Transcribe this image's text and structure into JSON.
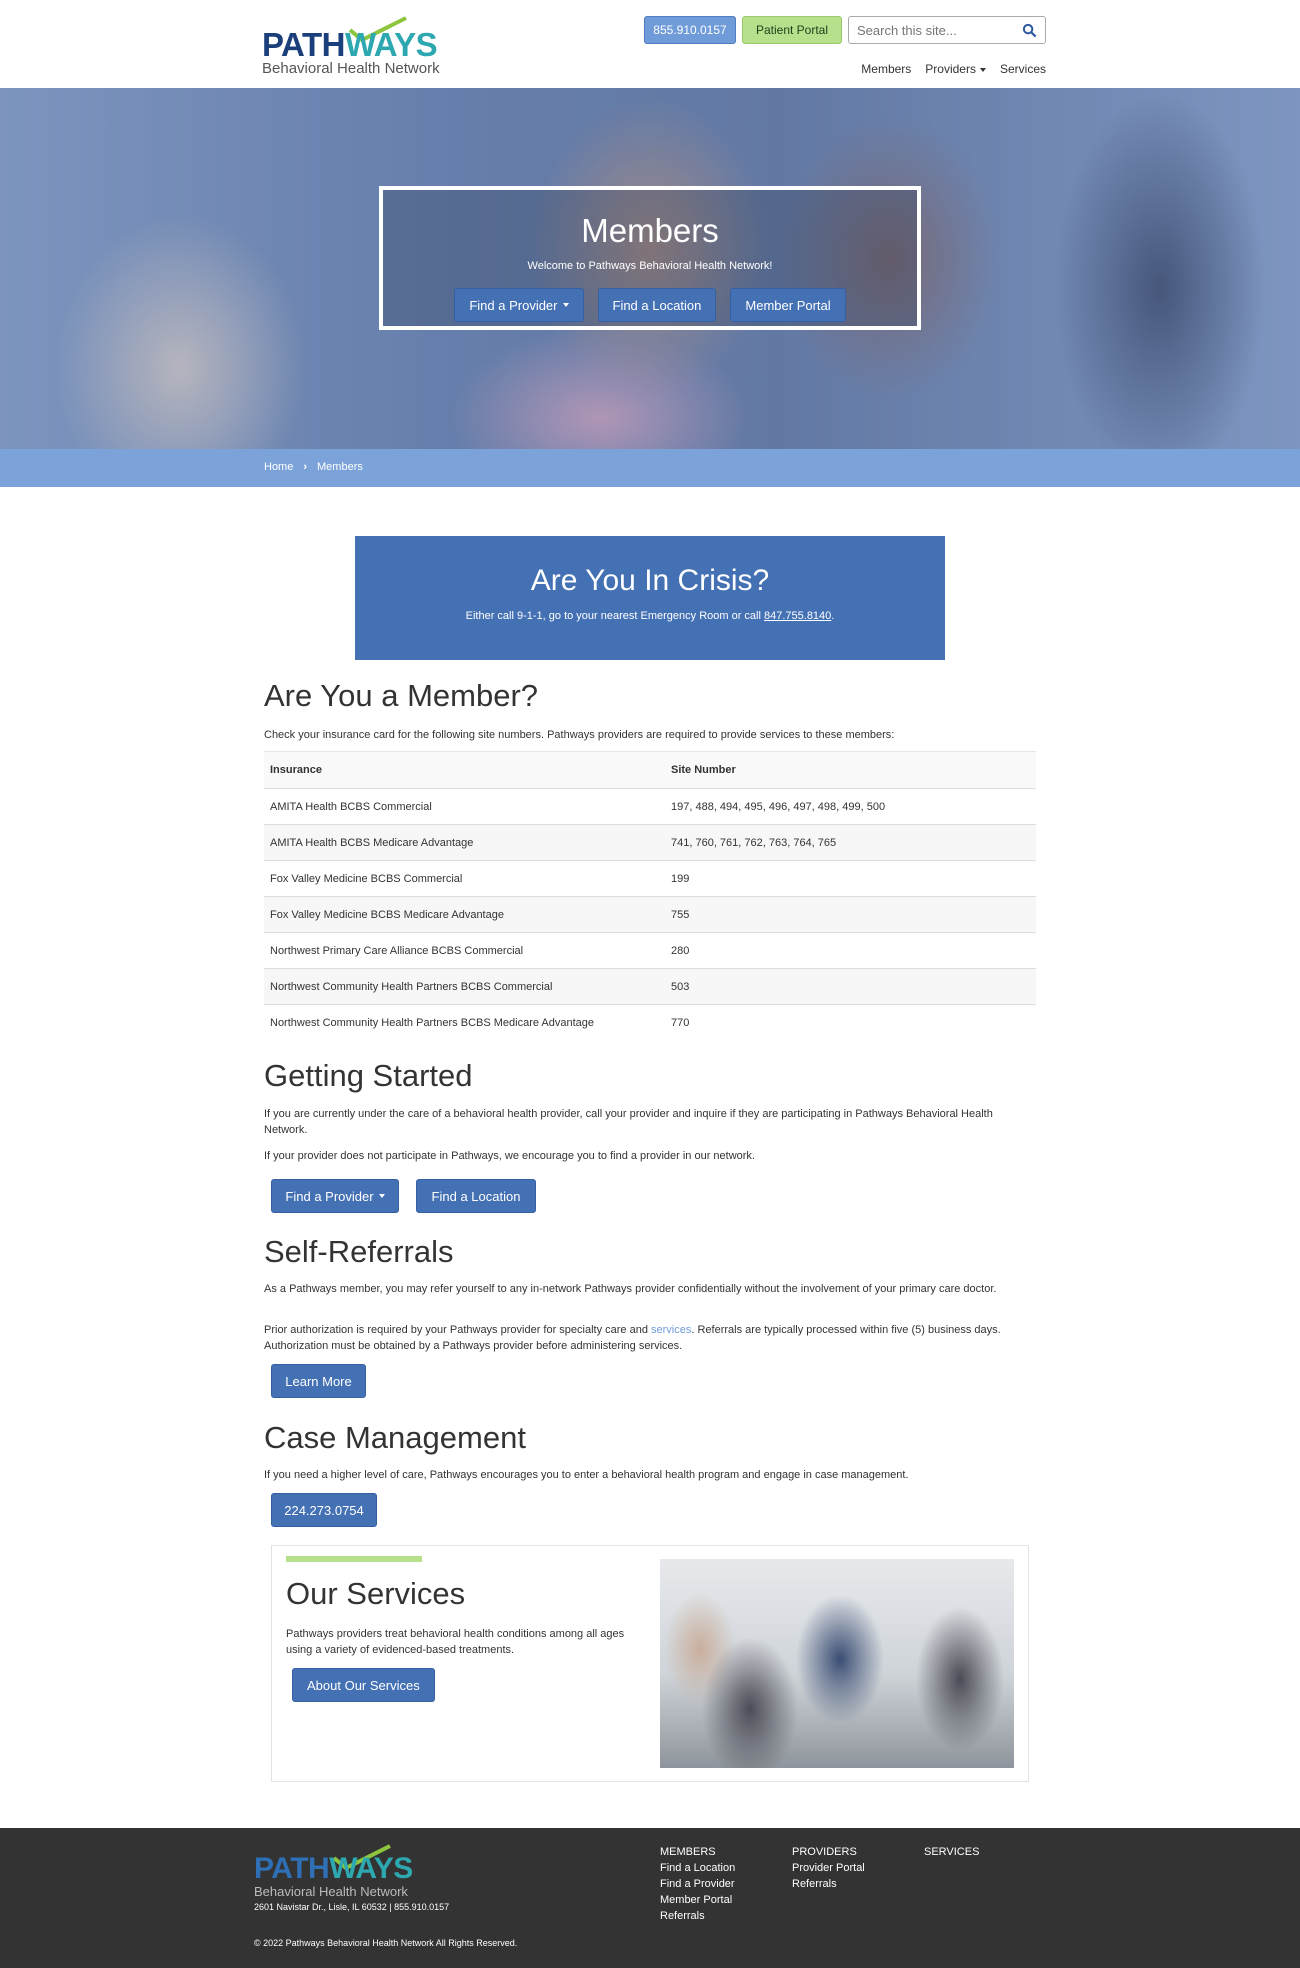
{
  "header": {
    "logo_word_dark": "PATH",
    "logo_word_teal": "WAYS",
    "logo_tagline": "Behavioral Health Network",
    "phone_button": "855.910.0157",
    "portal_button": "Patient Portal",
    "search_placeholder": "Search this site...",
    "nav": [
      "Members",
      "Providers",
      "Services"
    ]
  },
  "hero": {
    "title": "Members",
    "subtitle": "Welcome to Pathways Behavioral Health Network!",
    "buttons": [
      "Find a Provider",
      "Find a Location",
      "Member Portal"
    ]
  },
  "breadcrumb": [
    "Home",
    "Members"
  ],
  "crisis": {
    "title": "Are You In Crisis?",
    "text_before": "Either call 9-1-1, go to your nearest Emergency Room or call ",
    "phone": "847.755.8140",
    "text_after": "."
  },
  "member": {
    "title": "Are You a Member?",
    "intro": "Check your insurance card for the following site numbers. Pathways providers are required to provide services to these members:",
    "headers": [
      "Insurance",
      "Site Number"
    ],
    "rows": [
      [
        "AMITA Health BCBS Commercial",
        "197, 488, 494, 495, 496, 497, 498, 499, 500"
      ],
      [
        "AMITA Health BCBS Medicare Advantage",
        "741, 760, 761, 762, 763, 764, 765"
      ],
      [
        "Fox Valley Medicine BCBS Commercial",
        "199"
      ],
      [
        "Fox Valley Medicine BCBS Medicare Advantage",
        "755"
      ],
      [
        "Northwest Primary Care Alliance BCBS Commercial",
        "280"
      ],
      [
        "Northwest Community Health Partners BCBS Commercial",
        "503"
      ],
      [
        "Northwest Community Health Partners BCBS Medicare Advantage",
        "770"
      ]
    ]
  },
  "getting_started": {
    "title": "Getting Started",
    "p1": "If you are currently under the care of a behavioral health provider, call your provider and inquire if they are participating in Pathways Behavioral Health Network.",
    "p2": "If your provider does not participate in Pathways, we encourage you to find a provider in our network.",
    "btn1": "Find a Provider",
    "btn2": "Find a Location"
  },
  "self_referrals": {
    "title": "Self-Referrals",
    "p1": "As a Pathways member, you may refer yourself to any in-network Pathways provider confidentially without the involvement of your primary care doctor.",
    "p2_before": "Prior authorization is required by your Pathways provider for specialty care and ",
    "p2_link": "services",
    "p2_after": ". Referrals are typically processed within five (5) business days. Authorization must be obtained by a Pathways provider before administering services.",
    "btn": "Learn More"
  },
  "case_management": {
    "title": "Case Management",
    "p1": "If you need a higher level of care, Pathways encourages you to enter a behavioral health program and engage in case management.",
    "btn": "224.273.0754"
  },
  "services_card": {
    "title": "Our Services",
    "text": "Pathways providers treat behavioral health conditions among all ages using a variety of evidenced-based treatments.",
    "btn": "About Our Services"
  },
  "footer": {
    "address": "2601 Navistar Dr., Lisle, IL 60532 | 855.910.0157",
    "copyright": "© 2022 Pathways Behavioral Health Network All Rights Reserved.",
    "col_members": {
      "heading": "MEMBERS",
      "links": [
        "Find a Location",
        "Find a Provider",
        "Member Portal",
        "Referrals"
      ]
    },
    "col_providers": {
      "heading": "PROVIDERS",
      "links": [
        "Provider Portal",
        "Referrals"
      ]
    },
    "col_services": {
      "heading": "SERVICES",
      "links": []
    }
  },
  "colors": {
    "primary_blue": "#4470b4",
    "light_blue": "#7ba3d9",
    "green": "#b7e08c",
    "footer": "#333333"
  }
}
